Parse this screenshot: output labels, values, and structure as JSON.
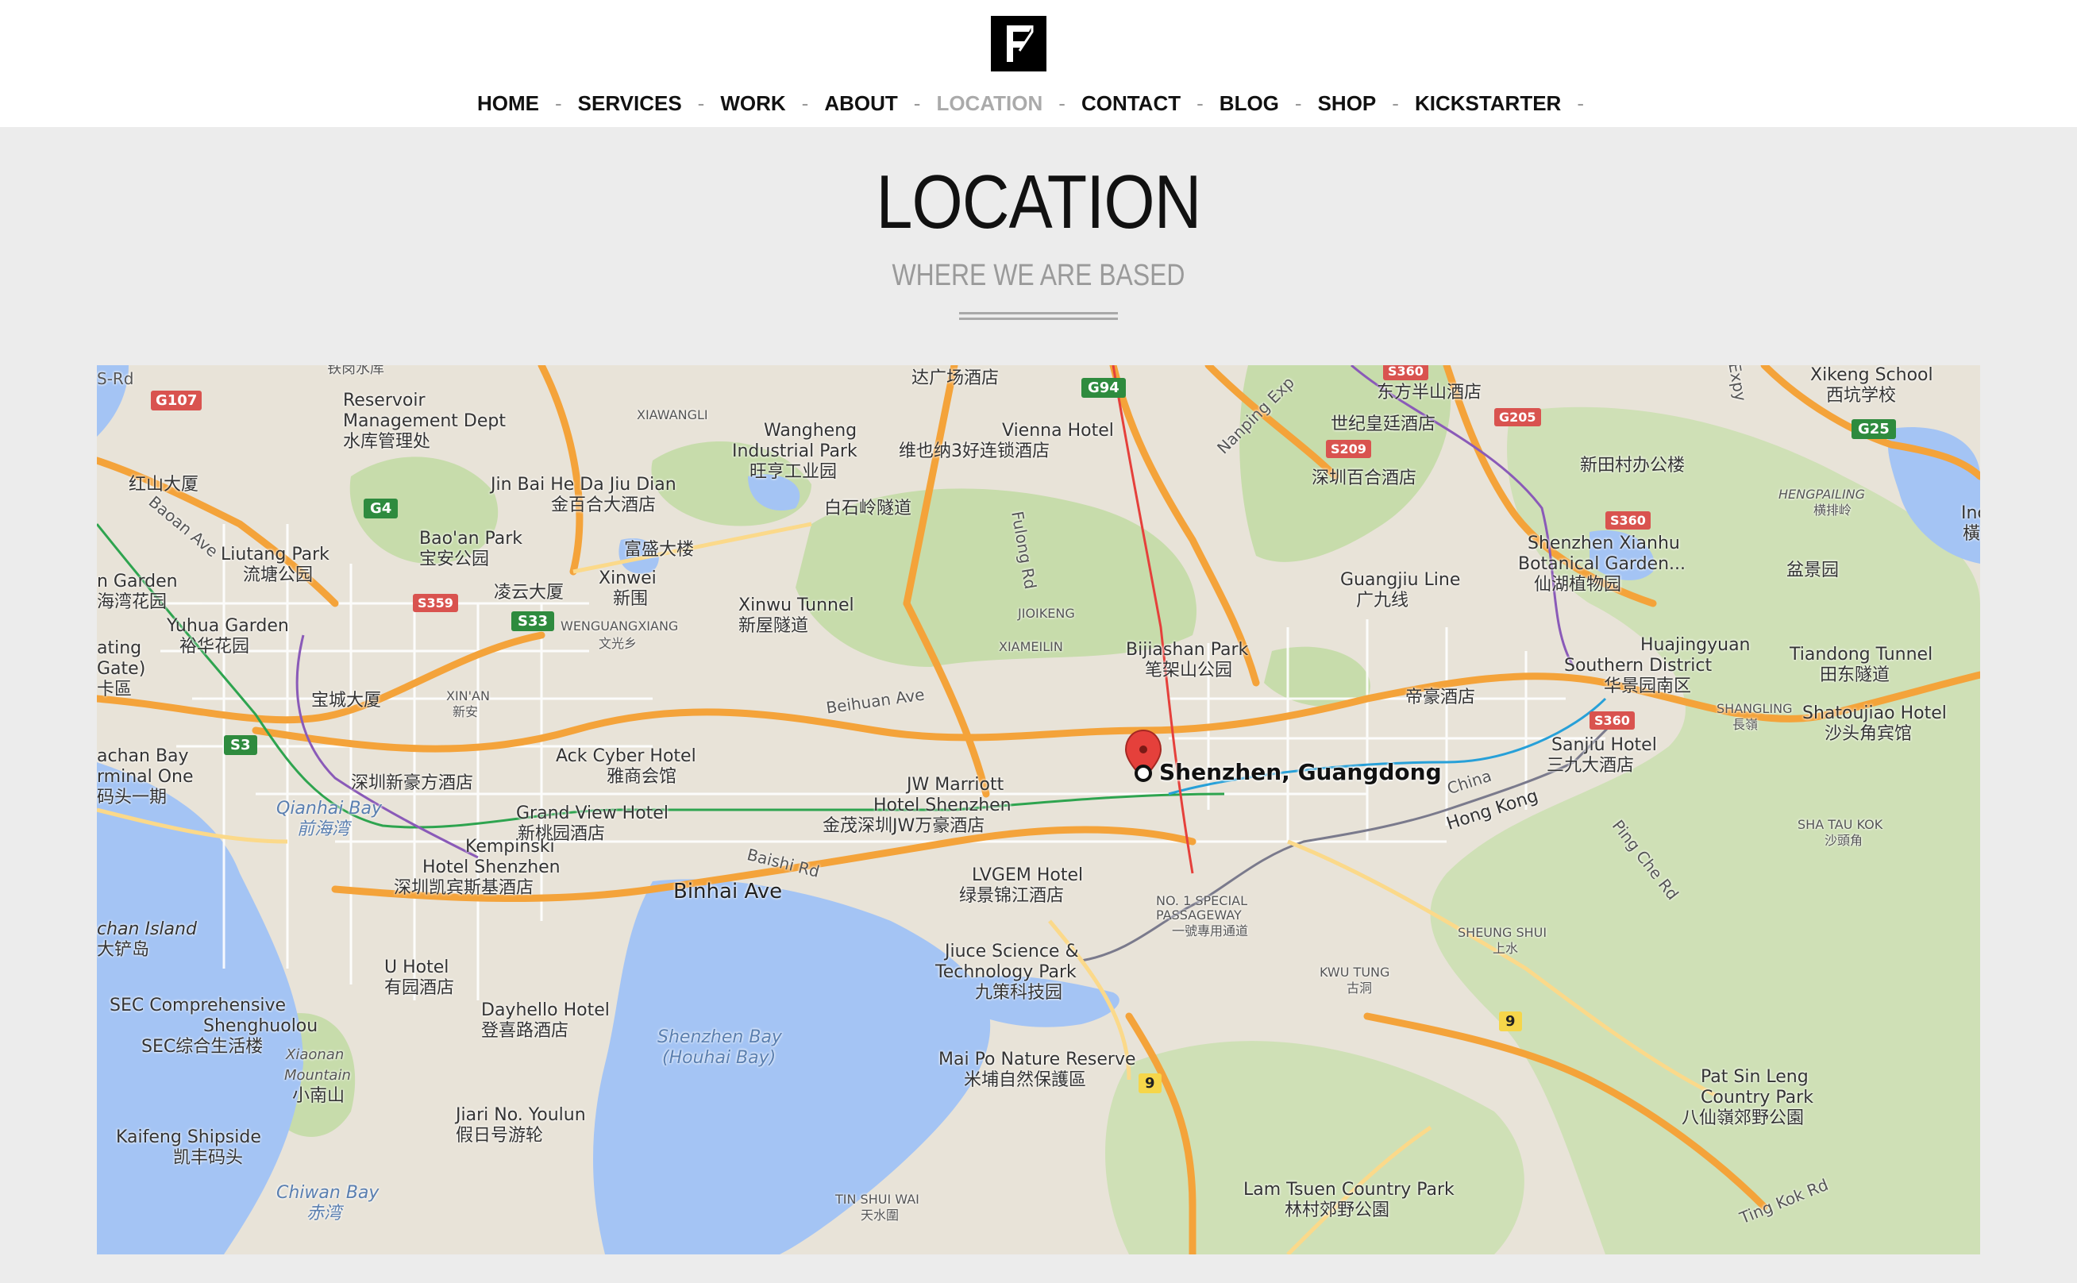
{
  "header": {
    "logo_alt": "F"
  },
  "nav": {
    "items": [
      {
        "label": "HOME"
      },
      {
        "label": "SERVICES"
      },
      {
        "label": "WORK"
      },
      {
        "label": "ABOUT"
      },
      {
        "label": "LOCATION",
        "active": true
      },
      {
        "label": "CONTACT"
      },
      {
        "label": "BLOG"
      },
      {
        "label": "SHOP"
      },
      {
        "label": "KICKSTARTER"
      }
    ],
    "separator": "-"
  },
  "page": {
    "title": "LOCATION",
    "subtitle": "WHERE WE ARE BASED"
  },
  "map": {
    "marker_label": "Shenzhen, Guangdong",
    "labels": {
      "l1": "Reservoir",
      "l2": "Management Dept",
      "l3": "水库管理处",
      "l4": "XIAWANGLI",
      "l5": "Wangheng",
      "l6": "Industrial Park",
      "l7": "旺亨工业园",
      "l8": "Vienna Hotel",
      "l9": "维也纳3好连锁酒店",
      "l10": "达广场酒店",
      "l11": "东方半山酒店",
      "l12": "世纪皇廷酒店",
      "l13": "深圳百合酒店",
      "l14": "Xikeng School",
      "l15": "西坑学校",
      "l16": "新田村办公楼",
      "l17": "红山大厦",
      "l18": "Jin Bai He Da Jiu Dian",
      "l19": "金百合大酒店",
      "l20": "白石岭隧道",
      "l21": "Liutang Park",
      "l22": "流塘公园",
      "l23": "Bao'an Park",
      "l24": "宝安公园",
      "l25": "富盛大楼",
      "l26": "凌云大厦",
      "l27": "Xinwei",
      "l28": "新围",
      "l29": "Xinwu Tunnel",
      "l30": "新屋隧道",
      "l31": "JIOIKENG",
      "l32": "XIAMEILIN",
      "l33": "Bijiashan Park",
      "l34": "笔架山公园",
      "l35": "Guangjiu Line",
      "l36": "广九线",
      "l37": "Shenzhen Xianhu",
      "l38": "Botanical Garden...",
      "l39": "仙湖植物园",
      "l40": "盆景园",
      "l41": "Yuhua Garden",
      "l42": "裕华花园",
      "l43": "WENGUANGXIANG",
      "l44": "文光乡",
      "l45": "Huajingyuan",
      "l46": "Southern District",
      "l47": "华景园南区",
      "l48": "Tiandong Tunnel",
      "l49": "田东隧道",
      "l50": "宝城大厦",
      "l51": "XIN'AN",
      "l52": "新安",
      "l53": "Beihuan Ave",
      "l54": "帝豪酒店",
      "l55": "Shatoujiao Hotel",
      "l56": "沙头角宾馆",
      "l57": "Sanjiu Hotel",
      "l58": "三九大酒店",
      "l59": "Ack Cyber Hotel",
      "l60": "雅商会馆",
      "l61": "深圳新豪方酒店",
      "l62": "JW Marriott",
      "l63": "Hotel Shenzhen",
      "l64": "金茂深圳JW万豪酒店",
      "l65": "Qianhai Bay",
      "l66": "前海湾",
      "l67": "Grand View Hotel",
      "l68": "新桃园酒店",
      "l69": "Baishi Rd",
      "l70": "Hong Kong",
      "l71": "China",
      "l72": "SHA TAU KOK",
      "l73": "沙頭角",
      "l74": "Kempinski",
      "l75": "Hotel Shenzhen",
      "l76": "深圳凯宾斯基酒店",
      "l77": "Binhai Ave",
      "l78": "LVGEM Hotel",
      "l79": "绿景锦江酒店",
      "l80": "NO. 1 SPECIAL",
      "l81": "PASSAGEWAY",
      "l82": "一號專用通道",
      "l83": "SHEUNG SHUI",
      "l84": "上水",
      "l85": "U Hotel",
      "l86": "有园酒店",
      "l87": "Jiuce Science &",
      "l88": "Technology Park",
      "l89": "九策科技园",
      "l90": "KWU TUNG",
      "l91": "古洞",
      "l92": "SEC Comprehensive",
      "l93": "Shenghuolou",
      "l94": "SEC综合生活楼",
      "l95": "Dayhello Hotel",
      "l96": "登喜路酒店",
      "l97": "Shenzhen Bay",
      "l98": "(Houhai Bay)",
      "l99": "Mai Po Nature Reserve",
      "l100": "米埔自然保護區",
      "l101": "Xiaonan",
      "l102": "Mountain",
      "l103": "小南山",
      "l104": "Jiari No. Youlun",
      "l105": "假日号游轮",
      "l106": "Pat Sin Leng",
      "l107": "Country Park",
      "l108": "八仙嶺郊野公園",
      "l109": "Kaifeng Shipside",
      "l110": "凯丰码头",
      "l111": "Chiwan Bay",
      "l112": "赤湾",
      "l113": "TIN SHUI WAI",
      "l114": "天水圍",
      "l115": "Lam Tsuen Country Park",
      "l116": "林村郊野公園",
      "l117": "Ting Kok Rd",
      "l118": "Ping Che Rd",
      "l119": "HENGPAILING",
      "l120": "横排岭",
      "l121": "SHANGLING",
      "l122": "長嶺",
      "l123": "Fulong Rd",
      "l124": "Nanping Exp",
      "l125": "Baoan Ave",
      "l126": "S-Rd",
      "l127": "n Garden",
      "l128": "海湾花园",
      "l129": "ating",
      "l130": "Gate)",
      "l131": "卡區",
      "l132": "achan Bay",
      "l133": "rminal One",
      "l134": "码头一期",
      "l135": "chan Island",
      "l136": "大铲岛",
      "l137": "铁岗水库",
      "l138": "Expy",
      "l139": "Inc",
      "l140": "橫"
    },
    "shields": {
      "g107": "G107",
      "g4": "G4",
      "s359": "S359",
      "s33": "S33",
      "s3": "S3",
      "g94": "G94",
      "s360a": "S360",
      "g205": "G205",
      "s209": "S209",
      "g25": "G25",
      "s360b": "S360",
      "s360c": "S360",
      "r9a": "9",
      "r9b": "9"
    }
  },
  "colors": {
    "header_bg": "#ffffff",
    "page_bg": "#ececec",
    "nav_active": "#aaaaaa",
    "water": "#a4c4f4",
    "park": "#c7dcab",
    "land": "#e8e3d8",
    "highway": "#f4a33a",
    "major_road": "#fbd98a",
    "marker": "#e5403b"
  }
}
